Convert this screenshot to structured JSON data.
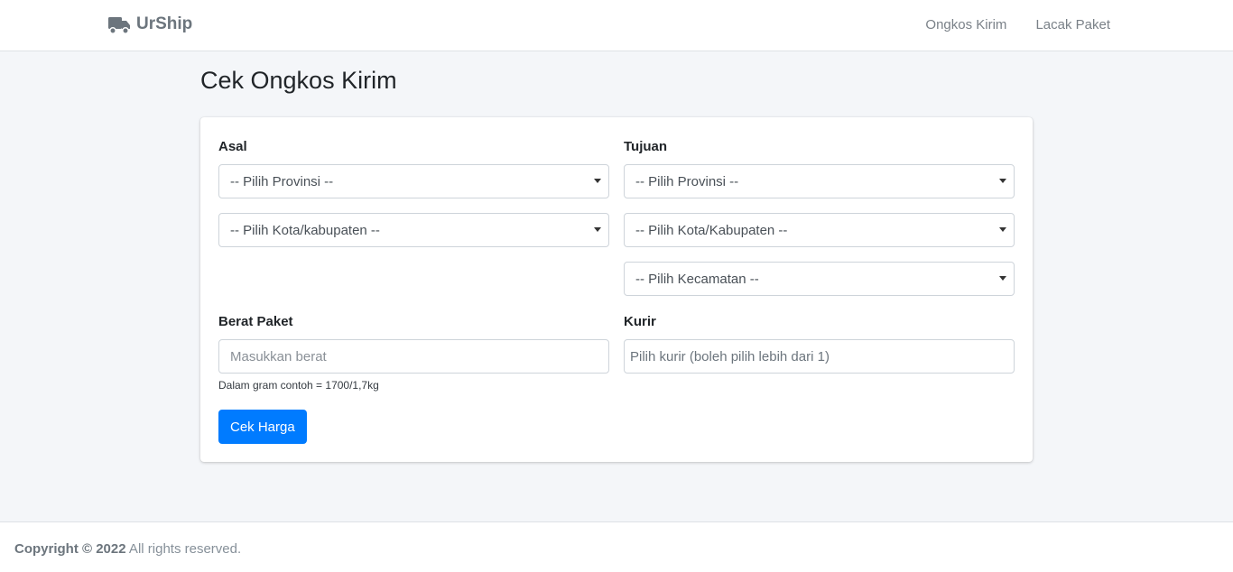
{
  "navbar": {
    "brand": "UrShip",
    "brand_icon": "truck-icon",
    "links": [
      "Ongkos Kirim",
      "Lacak Paket"
    ]
  },
  "page": {
    "title": "Cek Ongkos Kirim"
  },
  "form": {
    "origin": {
      "label": "Asal",
      "province": "-- Pilih Provinsi --",
      "city": "-- Pilih Kota/kabupaten --"
    },
    "destination": {
      "label": "Tujuan",
      "province": "-- Pilih Provinsi --",
      "city": "-- Pilih Kota/Kabupaten --",
      "district": "-- Pilih Kecamatan --"
    },
    "weight": {
      "label": "Berat Paket",
      "placeholder": "Masukkan berat",
      "help": "Dalam gram contoh = 1700/1,7kg"
    },
    "courier": {
      "label": "Kurir",
      "placeholder": "Pilih kurir (boleh pilih lebih dari 1)"
    },
    "submit_label": "Cek Harga"
  },
  "footer": {
    "copyright": "Copyright © 2022",
    "rights": " All rights reserved."
  },
  "colors": {
    "primary": "#007bff",
    "background": "#f4f6f9",
    "brand": "#6c757d"
  }
}
